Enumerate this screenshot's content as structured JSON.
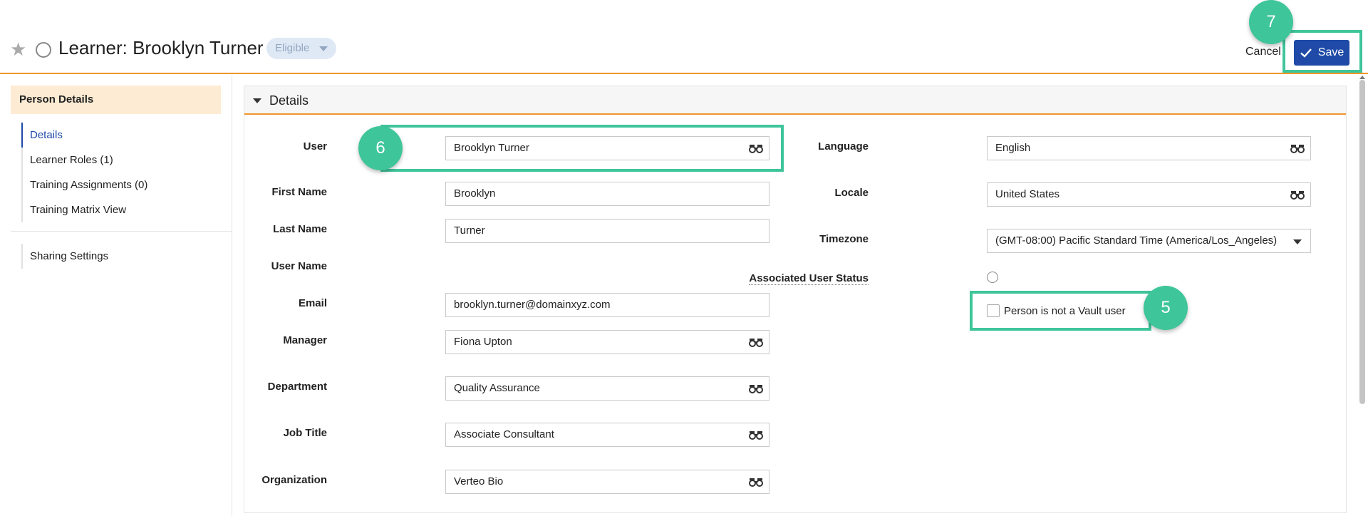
{
  "header": {
    "title": "Learner: Brooklyn Turner",
    "status_label": "Eligible",
    "cancel_label": "Cancel",
    "save_label": "Save"
  },
  "callouts": {
    "save": "7",
    "user": "6",
    "vault": "5"
  },
  "leftnav": {
    "header": "Person Details",
    "items": [
      {
        "label": "Details",
        "active": true
      },
      {
        "label": "Learner Roles (1)"
      },
      {
        "label": "Training Assignments (0)"
      },
      {
        "label": "Training Matrix View"
      }
    ],
    "sharing": "Sharing Settings"
  },
  "section": {
    "title": "Details"
  },
  "form_left": {
    "user": {
      "label": "User",
      "value": "Brooklyn Turner"
    },
    "first_name": {
      "label": "First Name",
      "value": "Brooklyn"
    },
    "last_name": {
      "label": "Last Name",
      "value": "Turner"
    },
    "user_name": {
      "label": "User Name"
    },
    "email": {
      "label": "Email",
      "value": "brooklyn.turner@domainxyz.com"
    },
    "manager": {
      "label": "Manager",
      "value": "Fiona Upton"
    },
    "department": {
      "label": "Department",
      "value": "Quality Assurance"
    },
    "job_title": {
      "label": "Job Title",
      "value": "Associate Consultant"
    },
    "organization": {
      "label": "Organization",
      "value": "Verteo Bio"
    }
  },
  "form_right": {
    "language": {
      "label": "Language",
      "value": "English"
    },
    "locale": {
      "label": "Locale",
      "value": "United States"
    },
    "timezone": {
      "label": "Timezone",
      "value": "(GMT-08:00) Pacific Standard Time (America/Los_Angeles)"
    },
    "assoc_status": {
      "label": "Associated User Status"
    },
    "not_vault": {
      "label": "Person is not a Vault user",
      "checked": false
    }
  },
  "colors": {
    "accent": "#f0952b",
    "primary": "#1f4aa7",
    "callout": "#3fc59a"
  },
  "icons": {
    "lookup": "binoculars-icon",
    "favorite": "star-icon"
  }
}
